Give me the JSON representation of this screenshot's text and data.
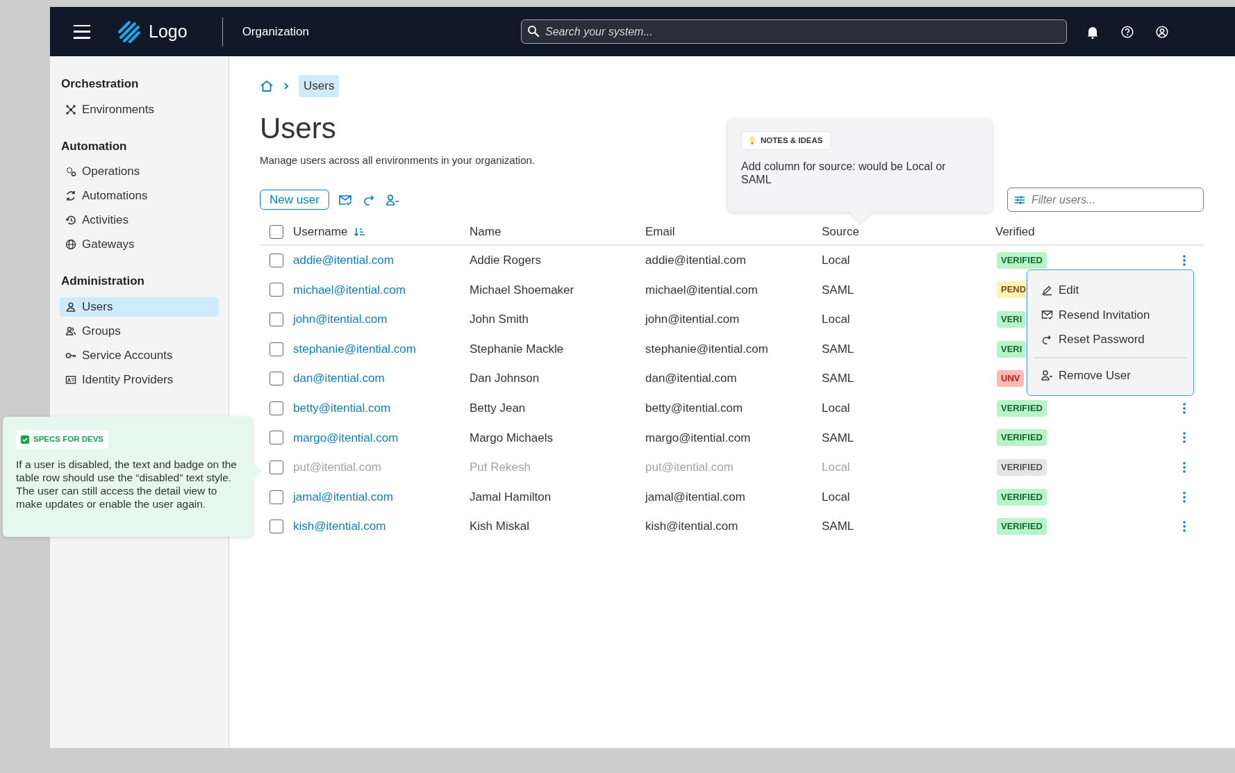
{
  "header": {
    "logo": "Logo",
    "org": "Organization",
    "search": {
      "placeholder": "Search your system..."
    }
  },
  "sidebar": {
    "sections": [
      {
        "heading": "Orchestration",
        "items": [
          {
            "label": "Environments",
            "kind": "network",
            "selected": false
          }
        ]
      },
      {
        "heading": "Automation",
        "items": [
          {
            "label": "Operations",
            "kind": "gears",
            "selected": false
          },
          {
            "label": "Automations",
            "kind": "cycle",
            "selected": false
          },
          {
            "label": "Activities",
            "kind": "history",
            "selected": false
          },
          {
            "label": "Gateways",
            "kind": "globe",
            "selected": false
          }
        ]
      },
      {
        "heading": "Administration",
        "items": [
          {
            "label": "Users",
            "kind": "user",
            "selected": true
          },
          {
            "label": "Groups",
            "kind": "users",
            "selected": false
          },
          {
            "label": "Service Accounts",
            "kind": "key",
            "selected": false
          },
          {
            "label": "Identity Providers",
            "kind": "idcard",
            "selected": false
          }
        ]
      }
    ]
  },
  "breadcrumb": {
    "current": "Users"
  },
  "page": {
    "title": "Users",
    "description": "Manage users across all environments in your organization."
  },
  "toolbar": {
    "new_button": "New user"
  },
  "filter": {
    "placeholder": "Filter users..."
  },
  "table": {
    "all_checked": false,
    "columns": [
      "Username",
      "Name",
      "Email",
      "Source",
      "Verified"
    ],
    "rows": [
      {
        "username": "addie@itential.com",
        "name": "Addie Rogers",
        "email": "addie@itential.com",
        "source": "Local",
        "badge": "VERIFIED",
        "kind": "verified",
        "disabled": false,
        "checked": false,
        "menu_button": true,
        "menu_open": true
      },
      {
        "username": "michael@itential.com",
        "name": "Michael Shoemaker",
        "email": "michael@itential.com",
        "source": "SAML",
        "badge": "PEND",
        "kind": "pending",
        "disabled": false,
        "checked": false,
        "menu_button": false,
        "menu_open": false
      },
      {
        "username": "john@itential.com",
        "name": "John Smith",
        "email": "john@itential.com",
        "source": "Local",
        "badge": "VERI",
        "kind": "verified",
        "disabled": false,
        "checked": false,
        "menu_button": false,
        "menu_open": false
      },
      {
        "username": "stephanie@itential.com",
        "name": "Stephanie Mackle",
        "email": "stephanie@itential.com",
        "source": "SAML",
        "badge": "VERI",
        "kind": "verified",
        "disabled": false,
        "checked": false,
        "menu_button": false,
        "menu_open": false
      },
      {
        "username": "dan@itential.com",
        "name": "Dan Johnson",
        "email": "dan@itential.com",
        "source": "SAML",
        "badge": "UNV",
        "kind": "unverified",
        "disabled": false,
        "checked": false,
        "menu_button": false,
        "menu_open": false
      },
      {
        "username": "betty@itential.com",
        "name": "Betty Jean",
        "email": "betty@itential.com",
        "source": "Local",
        "badge": "VERIFIED",
        "kind": "verified",
        "disabled": false,
        "checked": false,
        "menu_button": true,
        "menu_open": false
      },
      {
        "username": "margo@itential.com",
        "name": "Margo Michaels",
        "email": "margo@itential.com",
        "source": "SAML",
        "badge": "VERIFIED",
        "kind": "verified",
        "disabled": false,
        "checked": false,
        "menu_button": true,
        "menu_open": false
      },
      {
        "username": "put@itential.com",
        "name": "Put Rekesh",
        "email": "put@itential.com",
        "source": "Local",
        "badge": "VERIFIED",
        "kind": "verified",
        "disabled": true,
        "checked": false,
        "menu_button": true,
        "menu_open": false
      },
      {
        "username": "jamal@itential.com",
        "name": "Jamal Hamilton",
        "email": "jamal@itential.com",
        "source": "Local",
        "badge": "VERIFIED",
        "kind": "verified",
        "disabled": false,
        "checked": false,
        "menu_button": true,
        "menu_open": false
      },
      {
        "username": "kish@itential.com",
        "name": "Kish Miskal",
        "email": "kish@itential.com",
        "source": "SAML",
        "badge": "VERIFIED",
        "kind": "verified",
        "disabled": false,
        "checked": false,
        "menu_button": true,
        "menu_open": false
      }
    ]
  },
  "row_menu": {
    "items": [
      {
        "label": "Edit",
        "kind": "edit",
        "divider_before": false
      },
      {
        "label": "Resend Invitation",
        "kind": "mail",
        "divider_before": false
      },
      {
        "label": "Reset Password",
        "kind": "redo",
        "divider_before": false
      },
      {
        "label": "Remove User",
        "kind": "remove-user",
        "divider_before": true
      }
    ]
  },
  "notes": {
    "tag": "NOTES & IDEAS",
    "text": "Add column for source: would be Local or SAML"
  },
  "specs": {
    "tag": "SPECS FOR DEVS",
    "text": "If a user is disabled, the text and badge on the table row should use the “disabled” text style. The user can still access the detail view to make updates or enable the user again."
  }
}
